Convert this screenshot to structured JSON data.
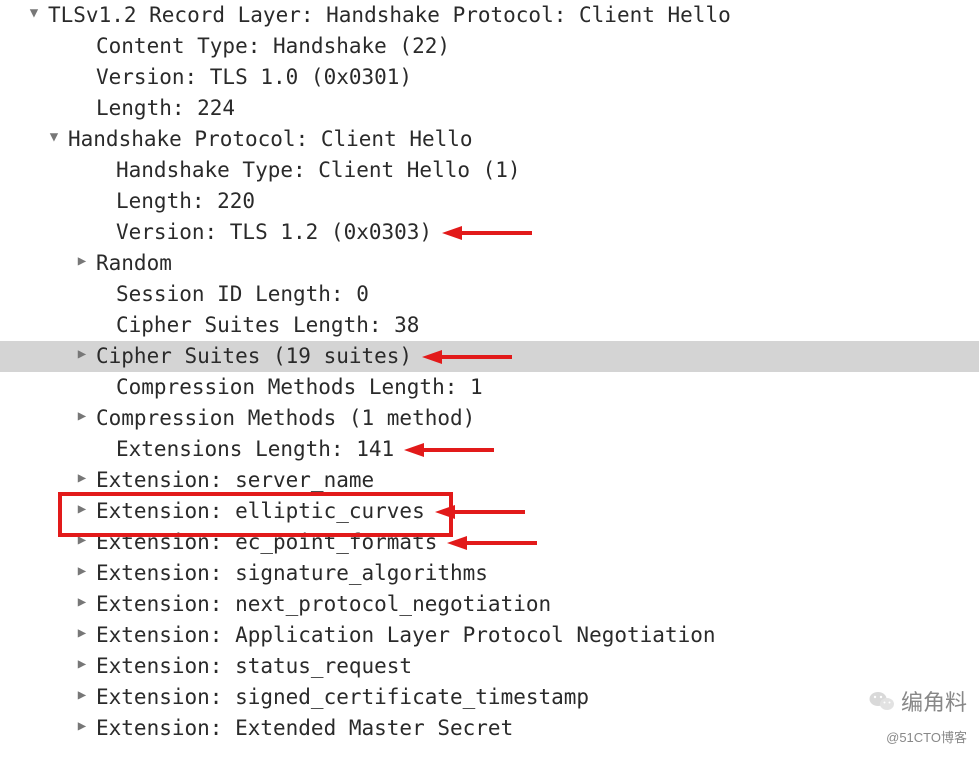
{
  "tree": [
    {
      "id": "rec-layer",
      "text": "TLSv1.2 Record Layer: Handshake Protocol: Client Hello",
      "tri": "down",
      "cls": "in0",
      "arrow": false,
      "sel": false,
      "box": false
    },
    {
      "id": "content-type",
      "text": "Content Type: Handshake (22)",
      "tri": "none",
      "cls": "in1",
      "arrow": false,
      "sel": false,
      "box": false
    },
    {
      "id": "rec-version",
      "text": "Version: TLS 1.0 (0x0301)",
      "tri": "none",
      "cls": "in1",
      "arrow": false,
      "sel": false,
      "box": false
    },
    {
      "id": "rec-length",
      "text": "Length: 224",
      "tri": "none",
      "cls": "in1",
      "arrow": false,
      "sel": false,
      "box": false
    },
    {
      "id": "hs-proto",
      "text": "Handshake Protocol: Client Hello",
      "tri": "down",
      "cls": "in2",
      "arrow": false,
      "sel": false,
      "box": false
    },
    {
      "id": "hs-type",
      "text": "Handshake Type: Client Hello (1)",
      "tri": "none",
      "cls": "in3",
      "arrow": false,
      "sel": false,
      "box": false
    },
    {
      "id": "hs-length",
      "text": "Length: 220",
      "tri": "none",
      "cls": "in3",
      "arrow": false,
      "sel": false,
      "box": false
    },
    {
      "id": "hs-version",
      "text": "Version: TLS 1.2 (0x0303)",
      "tri": "none",
      "cls": "in3",
      "arrow": true,
      "sel": false,
      "box": false
    },
    {
      "id": "random",
      "text": "Random",
      "tri": "right",
      "cls": "in1",
      "arrow": false,
      "sel": false,
      "box": false
    },
    {
      "id": "sid-len",
      "text": "Session ID Length: 0",
      "tri": "none",
      "cls": "in3",
      "arrow": false,
      "sel": false,
      "box": false
    },
    {
      "id": "cs-len",
      "text": "Cipher Suites Length: 38",
      "tri": "none",
      "cls": "in3",
      "arrow": false,
      "sel": false,
      "box": false
    },
    {
      "id": "cs",
      "text": "Cipher Suites (19 suites)",
      "tri": "right",
      "cls": "in1",
      "arrow": true,
      "sel": true,
      "box": false
    },
    {
      "id": "cm-len",
      "text": "Compression Methods Length: 1",
      "tri": "none",
      "cls": "in3",
      "arrow": false,
      "sel": false,
      "box": false
    },
    {
      "id": "cm",
      "text": "Compression Methods (1 method)",
      "tri": "right",
      "cls": "in1",
      "arrow": false,
      "sel": false,
      "box": false
    },
    {
      "id": "ext-len",
      "text": "Extensions Length: 141",
      "tri": "none",
      "cls": "in3",
      "arrow": true,
      "sel": false,
      "box": false
    },
    {
      "id": "ext-sni",
      "text": "Extension: server_name",
      "tri": "right",
      "cls": "in1",
      "arrow": false,
      "sel": false,
      "box": false
    },
    {
      "id": "ext-ec",
      "text": "Extension: elliptic_curves",
      "tri": "right",
      "cls": "in1",
      "arrow": true,
      "sel": false,
      "box": true
    },
    {
      "id": "ext-ecpf",
      "text": "Extension: ec_point_formats",
      "tri": "right",
      "cls": "in1",
      "arrow": true,
      "sel": false,
      "box": false
    },
    {
      "id": "ext-sig",
      "text": "Extension: signature_algorithms",
      "tri": "right",
      "cls": "in1",
      "arrow": false,
      "sel": false,
      "box": false
    },
    {
      "id": "ext-npn",
      "text": "Extension: next_protocol_negotiation",
      "tri": "right",
      "cls": "in1",
      "arrow": false,
      "sel": false,
      "box": false
    },
    {
      "id": "ext-alpn",
      "text": "Extension: Application Layer Protocol Negotiation",
      "tri": "right",
      "cls": "in1",
      "arrow": false,
      "sel": false,
      "box": false
    },
    {
      "id": "ext-status",
      "text": "Extension: status_request",
      "tri": "right",
      "cls": "in1",
      "arrow": false,
      "sel": false,
      "box": false
    },
    {
      "id": "ext-sct",
      "text": "Extension: signed_certificate_timestamp",
      "tri": "right",
      "cls": "in1",
      "arrow": false,
      "sel": false,
      "box": false
    },
    {
      "id": "ext-ems",
      "text": "Extension: Extended Master Secret",
      "tri": "right",
      "cls": "in1",
      "arrow": false,
      "sel": false,
      "box": false
    }
  ],
  "credit": {
    "line1": "编角料",
    "line2": "@51CTO博客"
  },
  "colors": {
    "arrow": "#e21a1a",
    "box": "#e21a1a",
    "selection": "#d4d4d4"
  }
}
